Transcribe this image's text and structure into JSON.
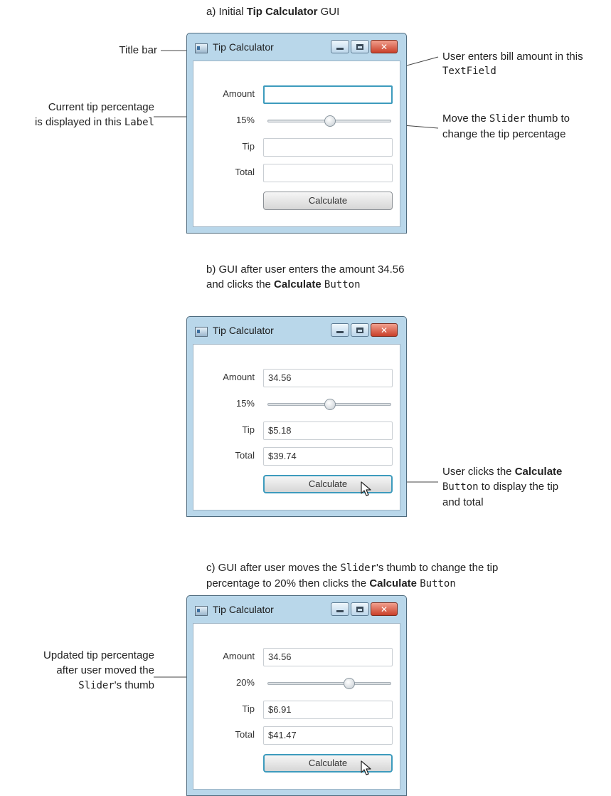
{
  "captions": {
    "a": {
      "prefix": "a) Initial ",
      "bold": "Tip Calculator",
      "suffix": " GUI"
    },
    "b": {
      "line1": "b) GUI after user enters the amount 34.56",
      "line2_prefix": "and clicks the ",
      "line2_bold": "Calculate",
      "line2_mono": "Button"
    },
    "c": {
      "line1_prefix": "c) GUI after user moves the ",
      "line1_mono": "Slider",
      "line1_suffix": "'s thumb to change the tip",
      "line2_prefix": "percentage to 20% then clicks the ",
      "line2_bold": "Calculate",
      "line2_mono": "Button"
    }
  },
  "annotations": {
    "title_bar": "Title bar",
    "current_tip_line1": "Current tip percentage",
    "current_tip_line2_prefix": "is displayed in this ",
    "current_tip_line2_mono": "Label",
    "amount_line1": "User enters bill amount in this",
    "amount_line2_mono": "TextField",
    "slider_line1_prefix": "Move the ",
    "slider_line1_mono": "Slider",
    "slider_line1_suffix": " thumb to",
    "slider_line2": "change the tip percentage",
    "click_line1_prefix": "User clicks the ",
    "click_line1_bold": "Calculate",
    "click_line2_mono": "Button",
    "click_line2_suffix": " to display the tip",
    "click_line3": "and total",
    "updated_line1": "Updated tip percentage",
    "updated_line2": "after user moved the",
    "updated_line3_mono": "Slider",
    "updated_line3_suffix": "'s thumb"
  },
  "windows": [
    {
      "title": "Tip Calculator",
      "labels": {
        "amount": "Amount",
        "tip": "Tip",
        "total": "Total"
      },
      "percent": "15%",
      "slider_fraction": 0.5,
      "amount_value": "",
      "tip_value": "",
      "total_value": "",
      "button_label": "Calculate"
    },
    {
      "title": "Tip Calculator",
      "labels": {
        "amount": "Amount",
        "tip": "Tip",
        "total": "Total"
      },
      "percent": "15%",
      "slider_fraction": 0.5,
      "amount_value": "34.56",
      "tip_value": "$5.18",
      "total_value": "$39.74",
      "button_label": "Calculate"
    },
    {
      "title": "Tip Calculator",
      "labels": {
        "amount": "Amount",
        "tip": "Tip",
        "total": "Total"
      },
      "percent": "20%",
      "slider_fraction": 0.67,
      "amount_value": "34.56",
      "tip_value": "$6.91",
      "total_value": "$41.47",
      "button_label": "Calculate"
    }
  ],
  "window_controls": {
    "min_icon": "minimize-icon",
    "max_icon": "maximize-icon",
    "close_icon": "close-icon",
    "close_glyph": "✕"
  }
}
